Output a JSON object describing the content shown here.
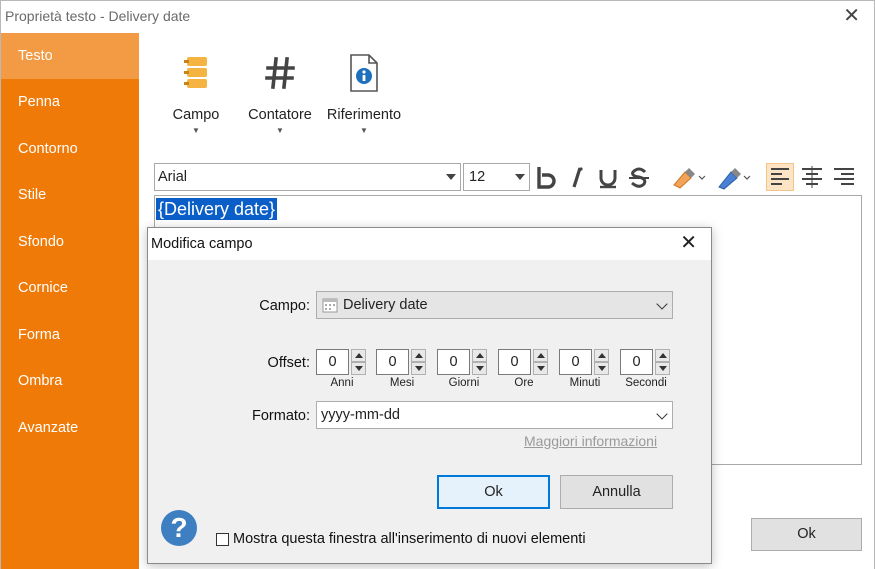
{
  "window": {
    "title": "Proprietà testo - Delivery date"
  },
  "sidebar": {
    "items": [
      {
        "label": "Testo",
        "active": true
      },
      {
        "label": "Penna"
      },
      {
        "label": "Contorno"
      },
      {
        "label": "Stile"
      },
      {
        "label": "Sfondo"
      },
      {
        "label": "Cornice"
      },
      {
        "label": "Forma"
      },
      {
        "label": "Ombra"
      },
      {
        "label": "Avanzate"
      }
    ]
  },
  "insert": {
    "campo": {
      "label": "Campo",
      "icon": "field-stack-icon"
    },
    "contatore": {
      "label": "Contatore",
      "icon": "hash-icon"
    },
    "riferimento": {
      "label": "Riferimento",
      "icon": "document-info-icon"
    }
  },
  "font": {
    "name": "Arial",
    "size": "12"
  },
  "editor": {
    "text": "{Delivery date}"
  },
  "main": {
    "ok_label": "Ok"
  },
  "dialog": {
    "title": "Modifica campo",
    "field_label": "Campo:",
    "field_value": "Delivery date",
    "offset_label": "Offset:",
    "offsets": [
      {
        "value": "0",
        "unit": "Anni"
      },
      {
        "value": "0",
        "unit": "Mesi"
      },
      {
        "value": "0",
        "unit": "Giorni"
      },
      {
        "value": "0",
        "unit": "Ore"
      },
      {
        "value": "0",
        "unit": "Minuti"
      },
      {
        "value": "0",
        "unit": "Secondi"
      }
    ],
    "format_label": "Formato:",
    "format_value": "yyyy-mm-dd",
    "more_info": "Maggiori informazioni",
    "ok_label": "Ok",
    "cancel_label": "Annulla",
    "help_glyph": "?",
    "checkbox_label": "Mostra questa finestra all'inserimento di nuovi elementi"
  },
  "colors": {
    "sidebar": "#f07a08",
    "sidebar_active": "#f39a44",
    "selection": "#0a5ec8",
    "accent": "#0078d7"
  }
}
